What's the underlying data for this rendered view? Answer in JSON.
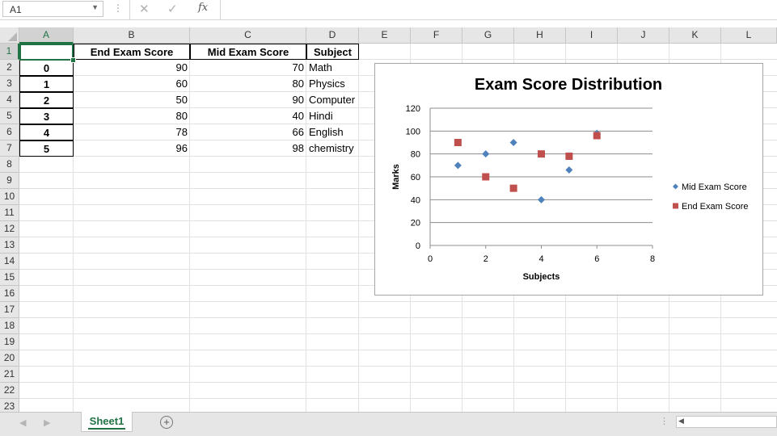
{
  "formula_bar": {
    "name_box": "A1",
    "name_box_dropdown_icon": "chevron-down-icon",
    "more_icon": "vertical-dots-icon",
    "cancel_icon": "x-icon",
    "enter_icon": "check-icon",
    "function_icon": "fx-icon",
    "fx_label": "fx",
    "formula": ""
  },
  "columns": [
    "A",
    "B",
    "C",
    "D",
    "E",
    "F",
    "G",
    "H",
    "I",
    "J",
    "K",
    "L"
  ],
  "rows": [
    "1",
    "2",
    "3",
    "4",
    "5",
    "6",
    "7",
    "8",
    "9",
    "10",
    "11",
    "12",
    "13",
    "14",
    "15",
    "16",
    "17",
    "18",
    "19",
    "20",
    "21",
    "22",
    "23"
  ],
  "table": {
    "headers": [
      "",
      "End Exam Score",
      "Mid Exam Score",
      "Subject"
    ],
    "rows": [
      [
        "0",
        "90",
        "70",
        "Math"
      ],
      [
        "1",
        "60",
        "80",
        "Physics"
      ],
      [
        "2",
        "50",
        "90",
        "Computer"
      ],
      [
        "3",
        "80",
        "40",
        "Hindi"
      ],
      [
        "4",
        "78",
        "66",
        "English"
      ],
      [
        "5",
        "96",
        "98",
        "chemistry"
      ]
    ]
  },
  "chart_data": {
    "type": "scatter",
    "title": "Exam Score Distribution",
    "xlabel": "Subjects",
    "ylabel": "Marks",
    "xlim": [
      0,
      8
    ],
    "ylim": [
      0,
      120
    ],
    "xticks": [
      "0",
      "2",
      "4",
      "6",
      "8"
    ],
    "yticks": [
      "0",
      "20",
      "40",
      "60",
      "80",
      "100",
      "120"
    ],
    "grid": "horizontal",
    "legend_position": "right",
    "series": [
      {
        "name": "Mid Exam Score",
        "marker": "diamond",
        "color": "#4f81bd",
        "points": [
          [
            1,
            70
          ],
          [
            2,
            80
          ],
          [
            3,
            90
          ],
          [
            4,
            40
          ],
          [
            5,
            66
          ],
          [
            6,
            98
          ]
        ]
      },
      {
        "name": "End Exam Score",
        "marker": "square",
        "color": "#c0504d",
        "points": [
          [
            1,
            90
          ],
          [
            2,
            60
          ],
          [
            3,
            50
          ],
          [
            4,
            80
          ],
          [
            5,
            78
          ],
          [
            6,
            96
          ]
        ]
      }
    ]
  },
  "sheet_tabs": {
    "active": "Sheet1",
    "add_icon": "plus-circle-icon",
    "nav_left_icon": "triangle-left-icon",
    "nav_right_icon": "triangle-right-icon"
  },
  "colors": {
    "accent": "#217346",
    "header_bg": "#e6e6e6"
  }
}
